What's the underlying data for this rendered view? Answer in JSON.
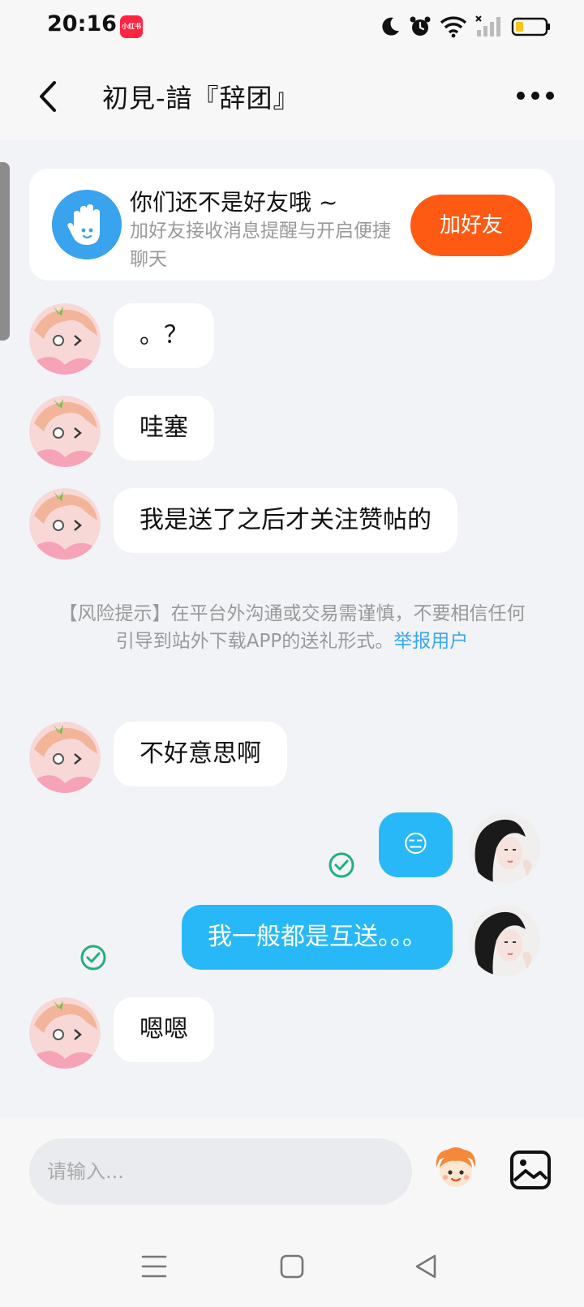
{
  "status_bar": {
    "time": "20:16",
    "app_badge": "小红书",
    "battery_color": "#f5c518"
  },
  "header": {
    "title": "初見-諳『辞团』"
  },
  "friend_card": {
    "title": "你们还不是好友哦 ~",
    "subtitle": "加好友接收消息提醒与开启便捷聊天",
    "button_label": "加好友"
  },
  "messages": [
    {
      "side": "in",
      "text": "。？"
    },
    {
      "side": "in",
      "text": "哇塞"
    },
    {
      "side": "in",
      "text": "我是送了之后才关注赞帖的"
    },
    {
      "side": "in",
      "text": "不好意思啊"
    },
    {
      "side": "out",
      "text": "😑"
    },
    {
      "side": "out",
      "text": "我一般都是互送。。。"
    },
    {
      "side": "in",
      "text": "嗯嗯"
    }
  ],
  "notice": {
    "text": "【风险提示】在平台外沟通或交易需谨慎，不要相信任何引导到站外下载APP的送礼形式。",
    "link": "举报用户"
  },
  "input": {
    "placeholder": "请输入..."
  },
  "colors": {
    "accent_orange": "#ff5a13",
    "bubble_out": "#28b8f7",
    "link_blue": "#3aa7ee",
    "check_green": "#22b07d"
  },
  "icons": {
    "back": "back-arrow-icon",
    "more": "more-dots-icon",
    "wave": "waving-hand-icon",
    "check": "check-circle-icon",
    "emoji": "emoji-face-icon",
    "image": "image-icon"
  }
}
